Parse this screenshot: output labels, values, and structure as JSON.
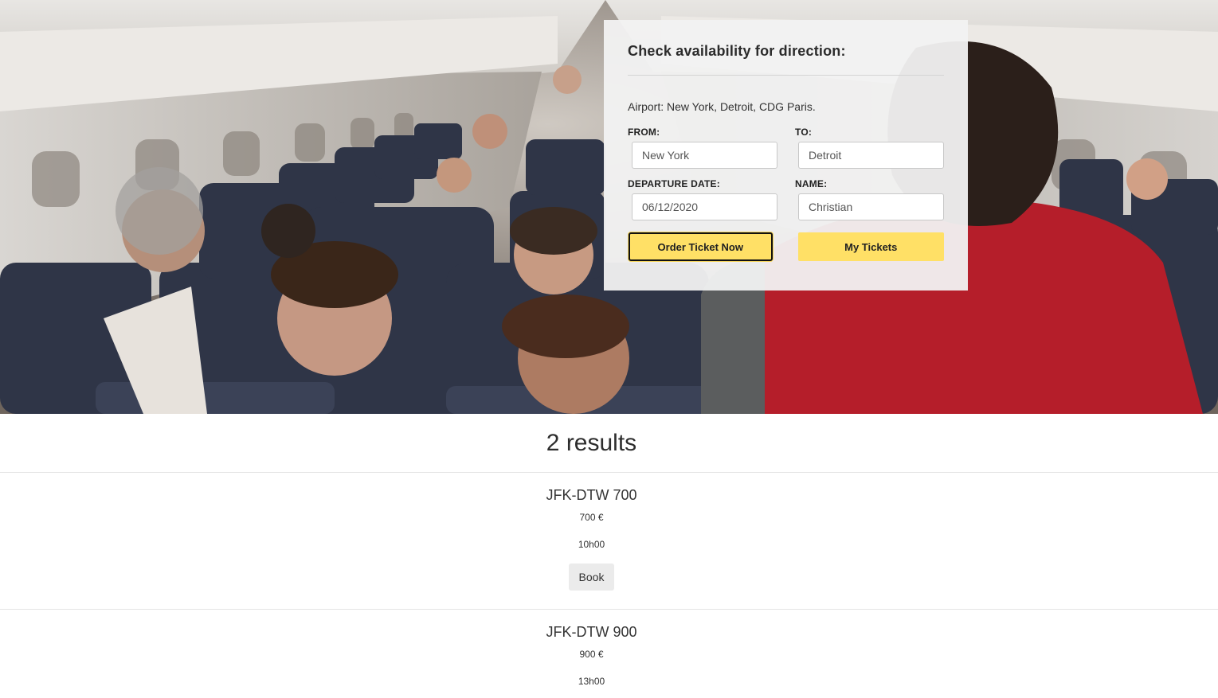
{
  "booking": {
    "title": "Check availability for direction:",
    "airports": "Airport: New York, Detroit, CDG Paris.",
    "from_label": "FROM:",
    "from_value": "New York",
    "to_label": "TO:",
    "to_value": "Detroit",
    "date_label": "DEPARTURE DATE:",
    "date_value": "06/12/2020",
    "name_label": "NAME:",
    "name_value": "Christian",
    "order_button": "Order Ticket Now",
    "tickets_button": "My Tickets"
  },
  "results": {
    "title": "2 results",
    "items": [
      {
        "name": "JFK-DTW 700",
        "price": "700 €",
        "duration": "10h00",
        "book_label": "Book"
      },
      {
        "name": "JFK-DTW 900",
        "price": "900 €",
        "duration": "13h00"
      }
    ]
  },
  "colors": {
    "accent_yellow": "#ffe066",
    "panel_bg": "#f2f2f2",
    "text_dark": "#2b2b2b"
  }
}
